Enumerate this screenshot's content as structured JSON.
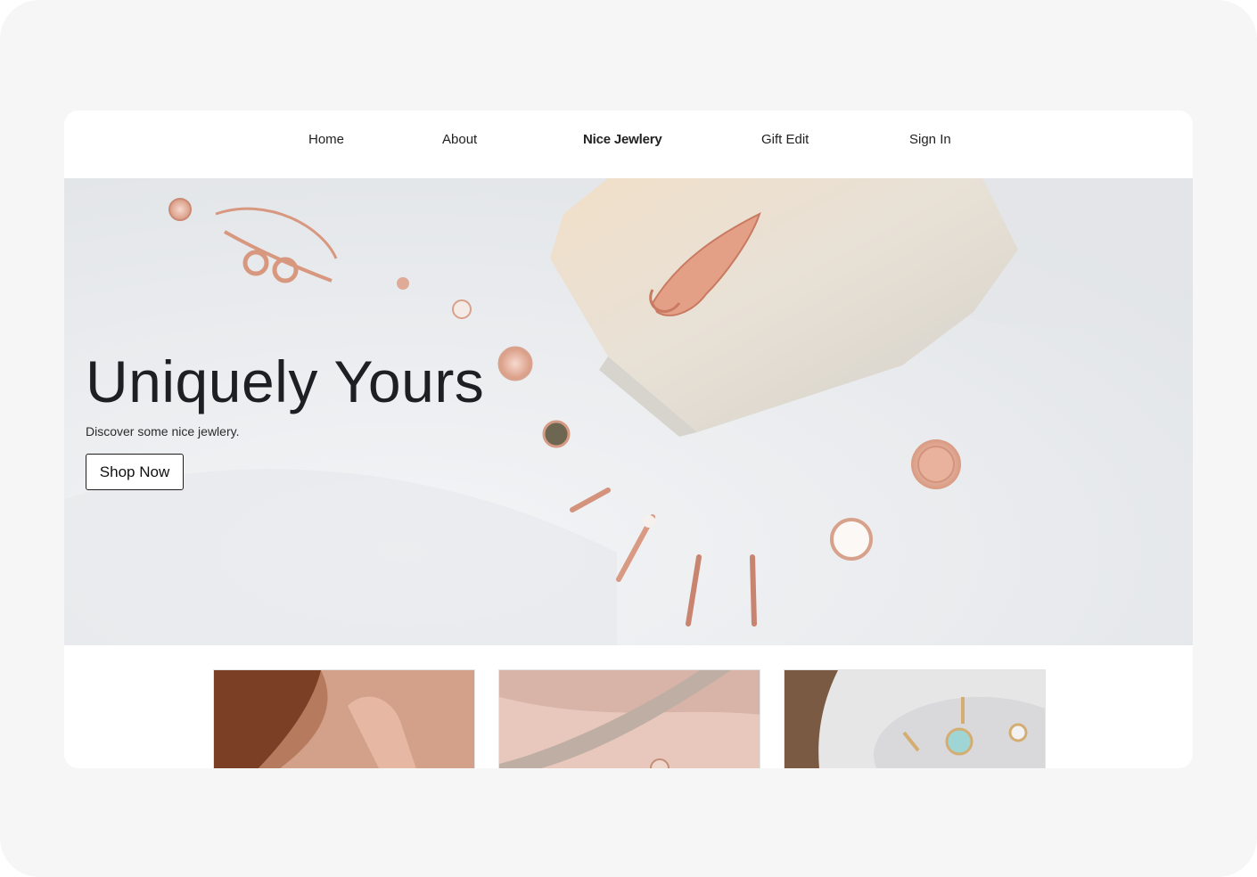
{
  "nav": {
    "items": [
      {
        "label": "Home"
      },
      {
        "label": "About"
      },
      {
        "label": "Nice Jewlery"
      },
      {
        "label": "Gift Edit"
      },
      {
        "label": "Sign In"
      }
    ]
  },
  "hero": {
    "title": "Uniquely Yours",
    "subtitle": "Discover some nice jewlery.",
    "cta_label": "Shop Now"
  },
  "colors": {
    "page_bg": "#f6f6f6",
    "card_bg": "#ffffff",
    "hero_bg": "#eceef0",
    "text": "#1e1f22",
    "rose_gold": "#d9957e"
  },
  "thumbnails": [
    {
      "name": "thumbnail-model-necklace"
    },
    {
      "name": "thumbnail-ring-ribbon"
    },
    {
      "name": "thumbnail-earrings-marble"
    }
  ]
}
